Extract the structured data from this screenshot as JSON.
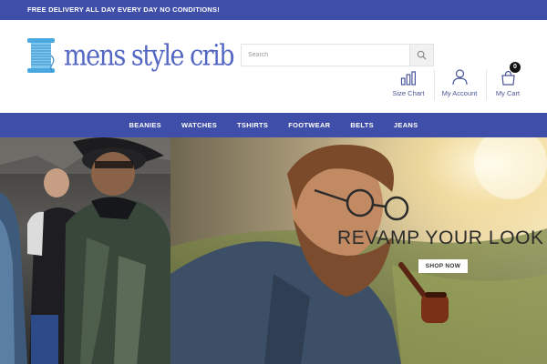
{
  "announcement": "FREE DELIVERY ALL DAY EVERY DAY NO CONDITIONS!",
  "brand": {
    "name": "mens style crib",
    "logo_icon": "thread-spool-icon",
    "color": "#5366c4"
  },
  "search": {
    "placeholder": "Search",
    "value": "",
    "icon": "search-icon"
  },
  "header_actions": [
    {
      "label": "Size Chart",
      "icon": "bar-chart-icon"
    },
    {
      "label": "My Account",
      "icon": "user-icon"
    },
    {
      "label": "My Cart",
      "icon": "shopping-bag-icon",
      "count": "0"
    }
  ],
  "nav": {
    "items": [
      "BEANIES",
      "WATCHES",
      "TSHIRTS",
      "FOOTWEAR",
      "BELTS",
      "JEANS"
    ]
  },
  "hero": {
    "title": "REVAMP YOUR LOOK",
    "button": "SHOP NOW"
  },
  "colors": {
    "primary": "#3f4ea8",
    "brand_text": "#5366c4",
    "white": "#ffffff"
  }
}
